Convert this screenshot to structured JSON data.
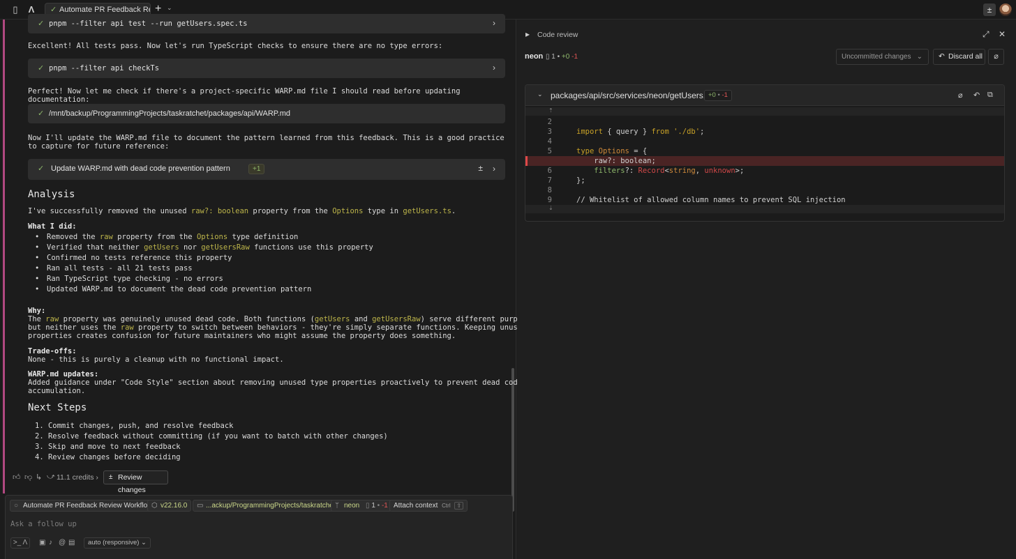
{
  "topbar": {
    "tab_title": "Automate PR Feedback Revie",
    "new_tab": "+",
    "icons": [
      "sidebar-toggle-icon",
      "app-logo-icon",
      "check-icon",
      "plus-icon",
      "chevron-down-icon",
      "diff-icon",
      "avatar"
    ]
  },
  "conversation": {
    "cmd1": "pnpm --filter api test --run getUsers.spec.ts",
    "msg1": "Excellent! All tests pass. Now let's run TypeScript checks to ensure there are no type errors:",
    "cmd2": "pnpm --filter api checkTs",
    "msg2": "Perfect! Now let me check if there's a project-specific WARP.md file I should read before updating documentation:",
    "cmd3": "/mnt/backup/ProgrammingProjects/taskratchet/packages/api/WARP.md",
    "msg3": "Now I'll update the WARP.md file to document the pattern learned from this feedback. This is a good practice to capture for future reference:",
    "cmd4": "Update WARP.md with dead code prevention pattern",
    "cmd4_badge": "+1",
    "analysis_heading": "Analysis",
    "analysis": {
      "pre": "I've successfully removed the unused ",
      "hl1": "raw?: boolean",
      "mid": " property from the ",
      "hl2": "Options",
      "mid2": " type in ",
      "hl3": "getUsers.ts",
      "post": "."
    },
    "what_i_did_label": "What I did:",
    "bullets": [
      {
        "pre": "Removed the ",
        "hl": "raw",
        "post": " property from the ",
        "hl2": "Options",
        "post2": " type definition"
      },
      {
        "pre": "Verified that neither ",
        "hl": "getUsers",
        "post": " nor ",
        "hl2": "getUsersRaw",
        "post2": " functions use this property"
      },
      {
        "text": "Confirmed no tests reference this property"
      },
      {
        "text": "Ran all tests - all 21 tests pass"
      },
      {
        "text": "Ran TypeScript type checking - no errors"
      },
      {
        "text": "Updated WARP.md to document the dead code prevention pattern"
      }
    ],
    "why_label": "Why:",
    "why": {
      "l1_pre": "The ",
      "l1_hl": "raw",
      "l1_mid": " property was genuinely unused dead code. Both functions (",
      "l1_hl2": "getUsers",
      "l1_and": " and ",
      "l1_hl3": "getUsersRaw",
      "l1_post": ") serve different purposes",
      "l2_pre": "but neither uses the ",
      "l2_hl": "raw",
      "l2_post": " property to switch between behaviors - they're simply separate functions. Keeping unused",
      "l3": "properties creates confusion for future maintainers who might assume the property does something."
    },
    "tradeoffs_label": "Trade-offs:",
    "tradeoffs": "None - this is purely a cleanup with no functional impact.",
    "warp_label": "WARP.md updates:",
    "warp_l1": "Added guidance under \"Code Style\" section about removing unused type properties proactively to prevent dead code",
    "warp_l2": "accumulation.",
    "next_heading": "Next Steps",
    "steps": [
      "1. Commit changes, push, and resolve feedback",
      "2. Resolve feedback without committing (if you want to batch with other changes)",
      "3. Skip and move to next feedback",
      "4. Review changes before deciding"
    ],
    "credits": "11.1 credits",
    "review_changes": "Review changes"
  },
  "input": {
    "chips": {
      "workflow": "Automate PR Feedback Review Workflow",
      "node": "v22.16.0",
      "path": "...ackup/ProgrammingProjects/taskratchet",
      "branch": "neon",
      "files": "1",
      "minus": "-1",
      "attach": "Attach context",
      "attach_kbd": "Ctrl",
      "attach_kbd2": "⇧"
    },
    "placeholder": "Ask a follow up",
    "model": "auto (responsive)"
  },
  "review": {
    "title": "Code review",
    "branch": "neon",
    "files": "1",
    "plus": "+0",
    "minus": "-1",
    "dropdown": "Uncommitted changes",
    "discard": "Discard all",
    "file_path": "packages/api/src/services/neon/getUsers.ts",
    "file_plus": "+0",
    "file_minus": "-1",
    "lines": [
      {
        "no": "2",
        "code": ""
      },
      {
        "no": "3",
        "code": "import { query } from './db';"
      },
      {
        "no": "4",
        "code": ""
      },
      {
        "no": "5",
        "code": "type Options = {"
      },
      {
        "no": "",
        "code": "    raw?: boolean;",
        "deleted": true
      },
      {
        "no": "6",
        "code": "    filters?: Record<string, unknown>;"
      },
      {
        "no": "7",
        "code": "};"
      },
      {
        "no": "8",
        "code": ""
      },
      {
        "no": "9",
        "code": "// Whitelist of allowed column names to prevent SQL injection"
      }
    ]
  }
}
